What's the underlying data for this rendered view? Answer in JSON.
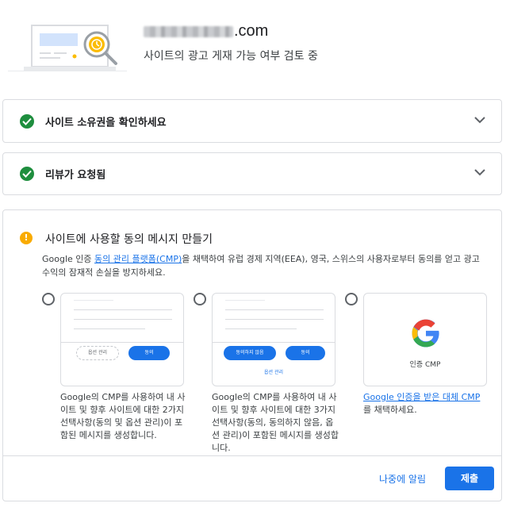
{
  "header": {
    "site_domain_suffix": ".com",
    "review_status": "사이트의 광고 게재 가능 여부 검토 중"
  },
  "panels": [
    {
      "title": "사이트 소유권을 확인하세요",
      "status": "complete"
    },
    {
      "title": "리뷰가 요청됨",
      "status": "complete"
    }
  ],
  "consent": {
    "title": "사이트에 사용할 동의 메시지 만들기",
    "desc_prefix": "Google 인증 ",
    "desc_link": "동의 관리 플랫폼(CMP)",
    "desc_suffix": "을 채택하여 유럽 경제 지역(EEA), 영국, 스위스의 사용자로부터 동의를 얻고 광고 수익의 잠재적 손실을 방지하세요.",
    "options": [
      {
        "buttons": [
          "옵션 관리",
          "동의"
        ],
        "description": "Google의 CMP를 사용하여 내 사이트 및 향후 사이트에 대한 2가지 선택사항(동의 및 옵션 관리)이 포함된 메시지를 생성합니다."
      },
      {
        "buttons": [
          "동의하지 않음",
          "동의"
        ],
        "link": "옵션 관리",
        "description": "Google의 CMP를 사용하여 내 사이트 및 향후 사이트에 대한 3가지 선택사항(동의, 동의하지 않음, 옵션 관리)이 포함된 메시지를 생성합니다."
      },
      {
        "card_label": "인증 CMP",
        "desc_link": "Google 인증을 받은 대체 CMP",
        "desc_suffix": "를 채택하세요."
      }
    ],
    "remind_label": "나중에 알림",
    "submit_label": "제출"
  },
  "colors": {
    "accent": "#1a73e8",
    "success": "#1e8e3e",
    "warning": "#f9ab00"
  }
}
